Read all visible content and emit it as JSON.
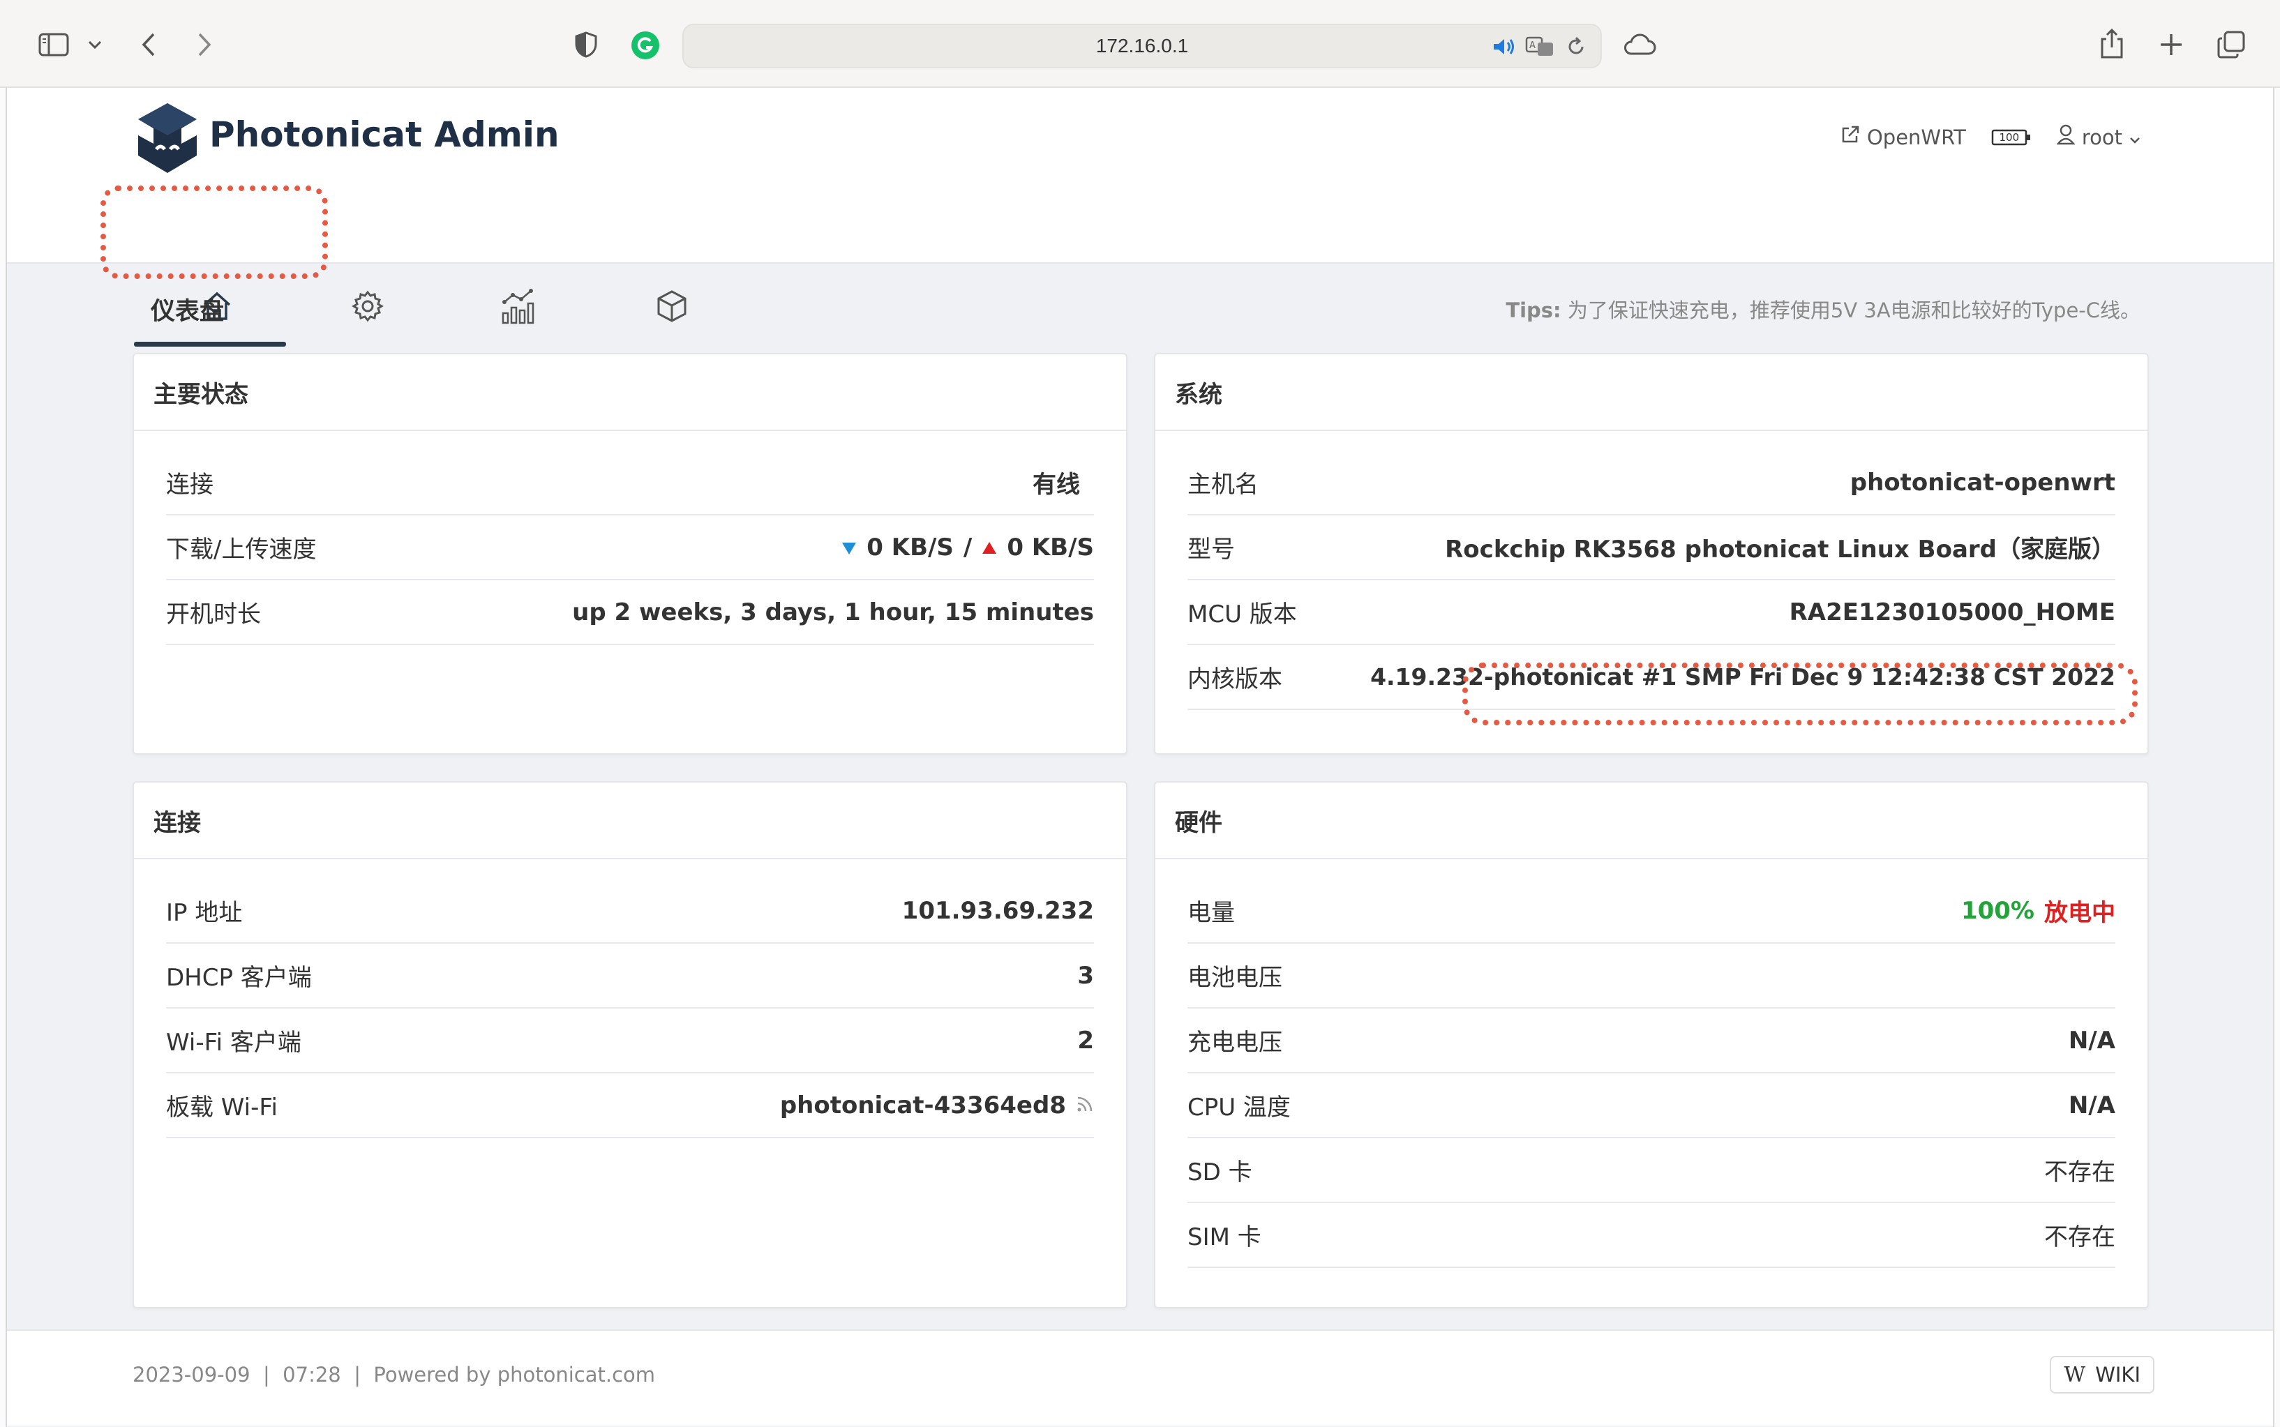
{
  "browser": {
    "url": "172.16.0.1",
    "icons": [
      "sidebar-icon",
      "chevron-down-icon",
      "back-icon",
      "forward-icon",
      "shield-icon",
      "grammarly-icon",
      "speaker-icon",
      "translate-icon",
      "reload-icon",
      "cloud-icon",
      "share-icon",
      "new-tab-icon",
      "tabs-icon"
    ]
  },
  "header": {
    "brand": "Photonicat Admin",
    "openwrt_link": "OpenWRT",
    "battery_level": "100",
    "user": "root"
  },
  "nav": {
    "tabs": [
      {
        "name": "home-icon",
        "active": true
      },
      {
        "name": "settings-icon",
        "active": false
      },
      {
        "name": "chart-icon",
        "active": false
      },
      {
        "name": "package-icon",
        "active": false
      }
    ]
  },
  "page": {
    "title": "仪表盘",
    "tips_label": "Tips:",
    "tips_text": "为了保证快速充电，推荐使用5V 3A电源和比较好的Type-C线。"
  },
  "main_status": {
    "title": "主要状态",
    "rows": {
      "connection": {
        "label": "连接",
        "value": "有线"
      },
      "speed": {
        "label": "下载/上传速度",
        "down": "0 KB/S",
        "sep": "/",
        "up": "0 KB/S"
      },
      "uptime": {
        "label": "开机时长",
        "value": "up 2 weeks, 3 days, 1 hour, 15 minutes"
      }
    }
  },
  "system": {
    "title": "系统",
    "rows": {
      "hostname": {
        "label": "主机名",
        "value": "photonicat-openwrt"
      },
      "model": {
        "label": "型号",
        "value": "Rockchip RK3568 photonicat Linux Board（家庭版）"
      },
      "mcu": {
        "label": "MCU 版本",
        "value": "RA2E1230105000_HOME"
      },
      "kernel": {
        "label": "内核版本",
        "value": "4.19.232-photonicat #1 SMP Fri Dec 9 12:42:38 CST 2022"
      }
    }
  },
  "connection": {
    "title": "连接",
    "rows": {
      "ip": {
        "label": "IP 地址",
        "value": "101.93.69.232"
      },
      "dhcp": {
        "label": "DHCP 客户端",
        "value": "3"
      },
      "wifi_clients": {
        "label": "Wi-Fi 客户端",
        "value": "2"
      },
      "onboard_wifi": {
        "label": "板载 Wi-Fi",
        "value": "photonicat-43364ed8"
      }
    }
  },
  "hardware": {
    "title": "硬件",
    "rows": {
      "battery": {
        "label": "电量",
        "percent": "100%",
        "state": "放电中"
      },
      "battery_voltage": {
        "label": "电池电压",
        "value": ""
      },
      "charge_voltage": {
        "label": "充电电压",
        "value": "N/A"
      },
      "cpu_temp": {
        "label": "CPU 温度",
        "value": "N/A"
      },
      "sd": {
        "label": "SD 卡",
        "value": "不存在"
      },
      "sim": {
        "label": "SIM 卡",
        "value": "不存在"
      }
    }
  },
  "footer": {
    "text": "2023-09-09  |  07:28  |  Powered by photonicat.com",
    "wiki": "WIKI"
  },
  "colors": {
    "accent_green": "#24a33a",
    "accent_red": "#e02020",
    "highlight_dotted": "#e55a43",
    "down_arrow": "#1e8fd6",
    "up_arrow": "#e02020"
  }
}
